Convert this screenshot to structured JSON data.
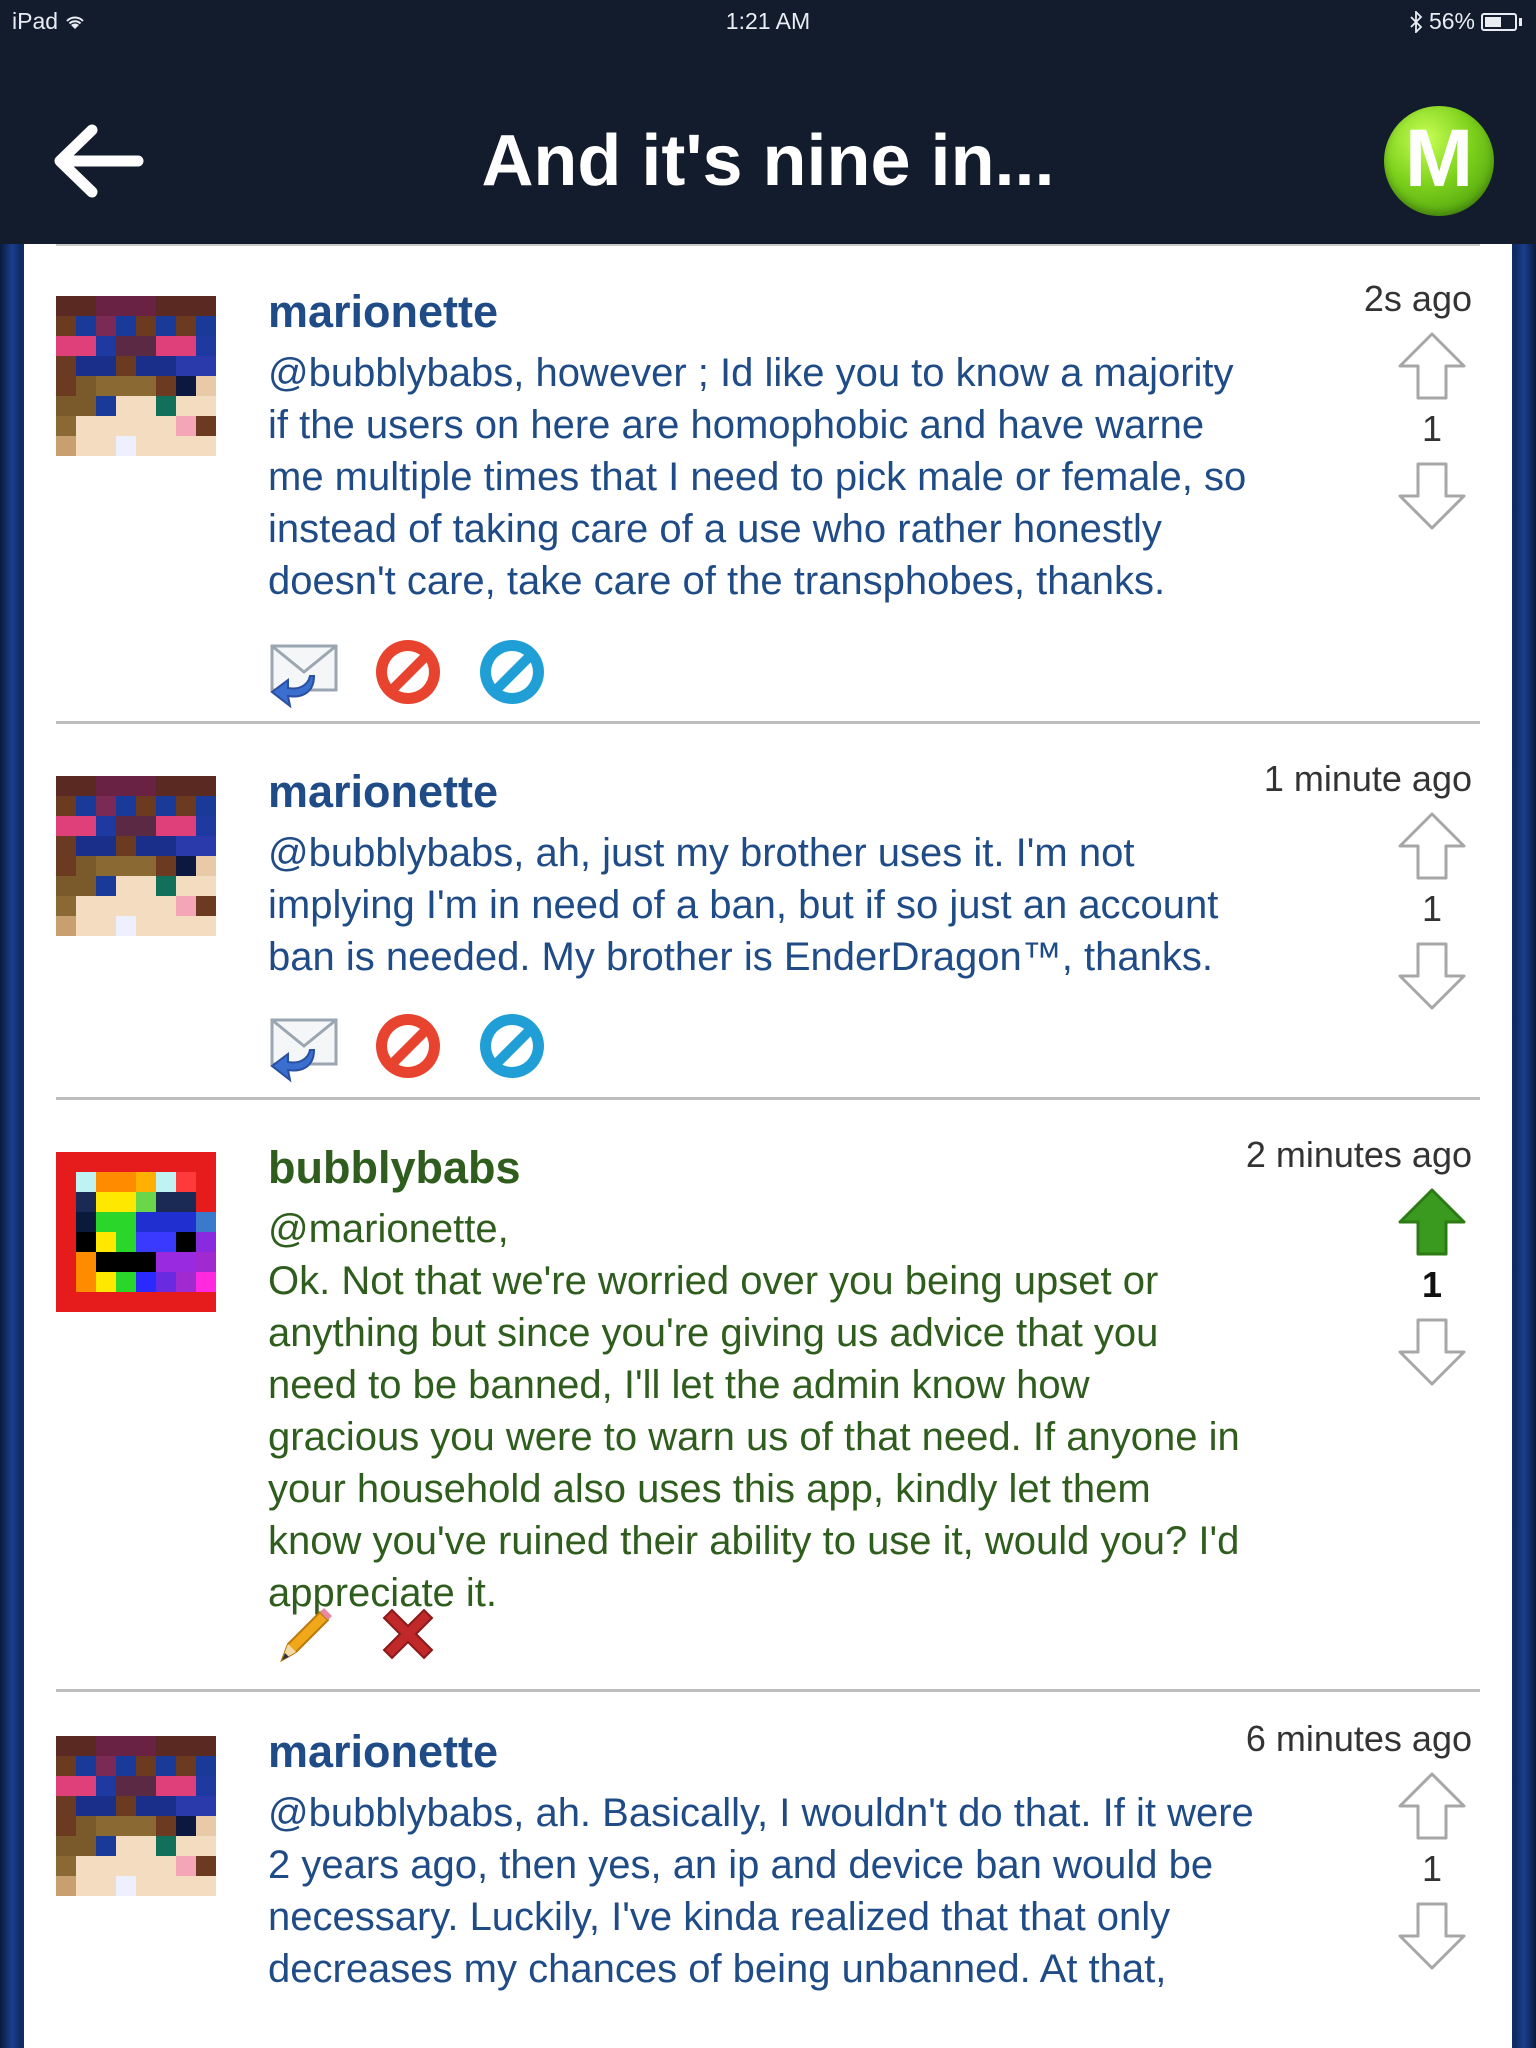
{
  "status_bar": {
    "device": "iPad",
    "time": "1:21 AM",
    "battery": "56%",
    "battery_level": 0.56
  },
  "nav": {
    "title": "And it's nine in..."
  },
  "brand": {
    "letter": "M"
  },
  "comments": [
    {
      "username": "marionette",
      "timestamp": "2s ago",
      "body": "@bubblybabs, however ; Id like you to know a majority\nif the users on here are homophobic and have warne\nme multiple times that I need to pick male or female, so\ninstead of taking care of a use who rather honestly\ndoesn't care, take care of the transphobes, thanks.",
      "score": "1"
    },
    {
      "username": "marionette",
      "timestamp": "1 minute ago",
      "body": "@bubblybabs, ah, just my brother uses it. I'm not\nimplying I'm in need of a ban, but if so just an account\nban is needed. My brother is EnderDragon™, thanks.",
      "score": "1"
    },
    {
      "username": "bubblybabs",
      "timestamp": "2 minutes ago",
      "body": "@marionette,\nOk. Not that we're worried over you being upset or\nanything but since you're giving us advice that you\nneed to be banned, I'll let the admin know how\ngracious you were to warn us of that need. If anyone in\nyour household also uses this app, kindly let them\nknow you've ruined their ability to use it, would you? I'd\nappreciate it.",
      "score": "1"
    },
    {
      "username": "marionette",
      "timestamp": "6 minutes ago",
      "body": "@bubblybabs, ah. Basically, I wouldn't do that. If it were\n2 years ago, then yes, an ip and device ban would be\nnecessary. Luckily, I've kinda realized that that only\ndecreases my chances of being unbanned. At that,",
      "score": "1"
    }
  ],
  "colors": {
    "other_user_text": "#1f4b86",
    "own_user_text": "#2f5d1d",
    "upvote_active": "#3a9a1f"
  }
}
